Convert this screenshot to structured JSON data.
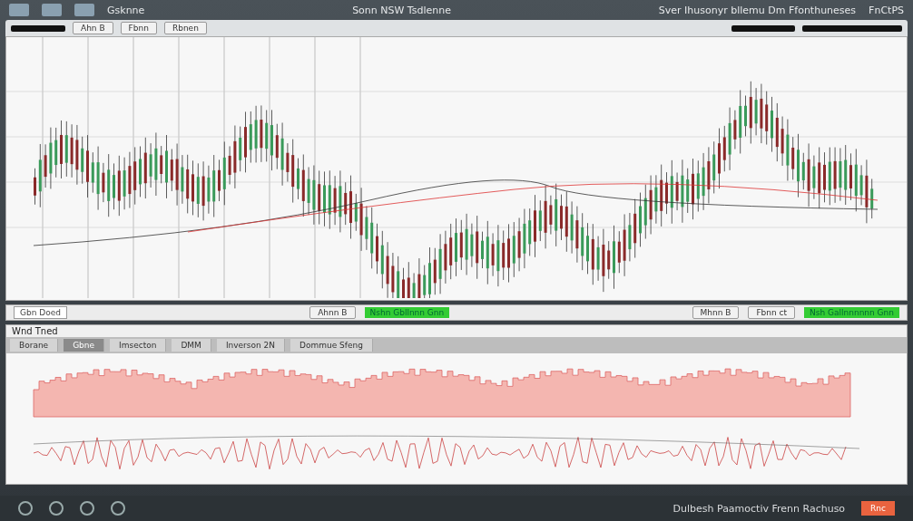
{
  "title_bar": {
    "app_name": "Gsknne",
    "center_title": "Sonn NSW Tsdlenne",
    "subtitle": "Sver Ihusonyr bllemu Dm Ffonthuneses",
    "right_label": "FnCtPS"
  },
  "chart_toolbar": {
    "buttons": [
      "Ahn B",
      "Fbnn",
      "Rbnen"
    ]
  },
  "strip": {
    "left_field": "Gbn Doed",
    "buttons": [
      "Ahnn B",
      "Mhnn B",
      "Fbnn ct"
    ],
    "green_labels": [
      "Nshn Gbllnnn Gnn",
      "Nsh Gallnnnnnn Gnn"
    ]
  },
  "indicator_panel": {
    "title": "Wnd Tned",
    "tabs": [
      {
        "label": "Borane",
        "selected": false
      },
      {
        "label": "Gbne",
        "selected": true
      },
      {
        "label": "Imsecton",
        "selected": false
      },
      {
        "label": "DMM",
        "selected": false
      },
      {
        "label": "Inverson 2N",
        "selected": false
      },
      {
        "label": "Dommue Sfeng",
        "selected": false
      }
    ]
  },
  "taskbar": {
    "status": "Dulbesh Paamoctiv Frenn Rachuso",
    "action": "Rnc"
  }
}
